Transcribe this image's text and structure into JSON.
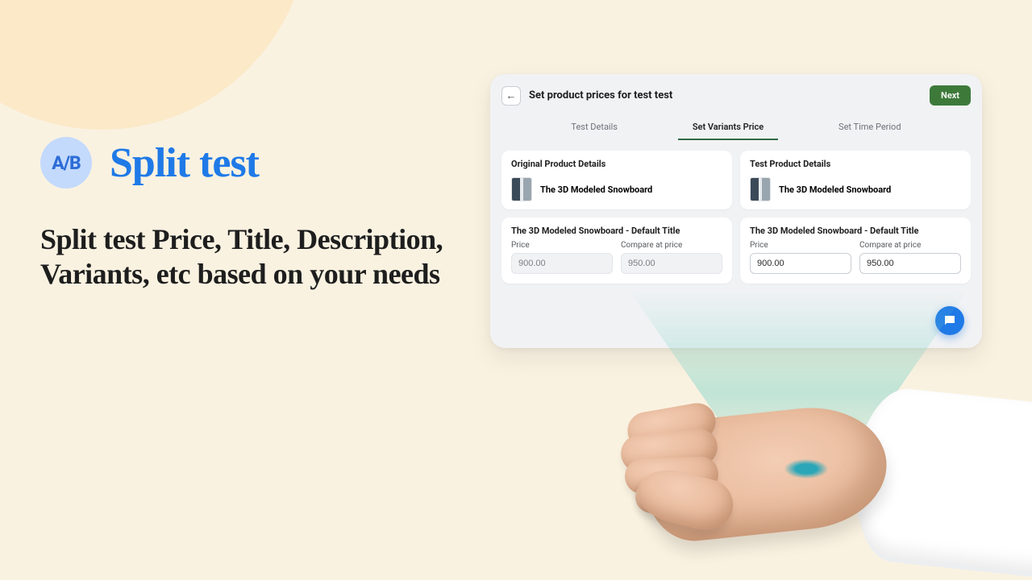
{
  "marketing": {
    "badge": "A/B",
    "title": "Split test",
    "description": "Split test Price, Title, Description, Variants, etc based on your needs"
  },
  "app": {
    "header": {
      "title": "Set product prices for test test",
      "next_label": "Next"
    },
    "tabs": [
      {
        "label": "Test Details",
        "active": false
      },
      {
        "label": "Set Variants Price",
        "active": true
      },
      {
        "label": "Set Time Period",
        "active": false
      }
    ],
    "panels": {
      "original": {
        "title": "Original Product Details",
        "product_name": "The 3D Modeled Snowboard",
        "variant_title": "The 3D Modeled Snowboard - Default Title",
        "price_label": "Price",
        "compare_label": "Compare at price",
        "price": "900.00",
        "compare": "950.00",
        "editable": false
      },
      "test": {
        "title": "Test Product Details",
        "product_name": "The 3D Modeled Snowboard",
        "variant_title": "The 3D Modeled Snowboard - Default Title",
        "price_label": "Price",
        "compare_label": "Compare at price",
        "price": "900.00",
        "compare": "950.00",
        "editable": true
      }
    }
  },
  "colors": {
    "accent_blue": "#1f7ae7",
    "accent_green": "#3d7a3a"
  }
}
